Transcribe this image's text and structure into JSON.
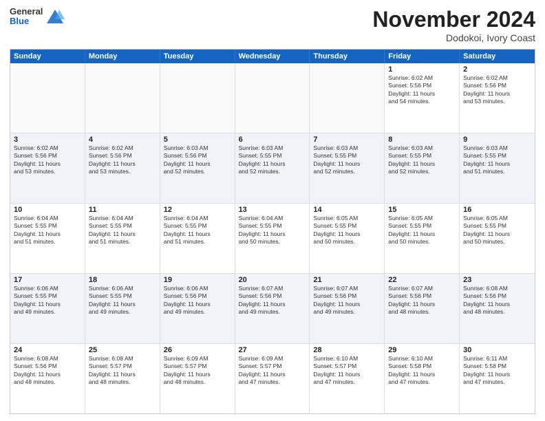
{
  "header": {
    "logo": {
      "general": "General",
      "blue": "Blue"
    },
    "title": "November 2024",
    "location": "Dodokoi, Ivory Coast"
  },
  "weekdays": [
    "Sunday",
    "Monday",
    "Tuesday",
    "Wednesday",
    "Thursday",
    "Friday",
    "Saturday"
  ],
  "rows": [
    [
      {
        "day": "",
        "info": ""
      },
      {
        "day": "",
        "info": ""
      },
      {
        "day": "",
        "info": ""
      },
      {
        "day": "",
        "info": ""
      },
      {
        "day": "",
        "info": ""
      },
      {
        "day": "1",
        "info": "Sunrise: 6:02 AM\nSunset: 5:56 PM\nDaylight: 11 hours\nand 54 minutes."
      },
      {
        "day": "2",
        "info": "Sunrise: 6:02 AM\nSunset: 5:56 PM\nDaylight: 11 hours\nand 53 minutes."
      }
    ],
    [
      {
        "day": "3",
        "info": "Sunrise: 6:02 AM\nSunset: 5:56 PM\nDaylight: 11 hours\nand 53 minutes."
      },
      {
        "day": "4",
        "info": "Sunrise: 6:02 AM\nSunset: 5:56 PM\nDaylight: 11 hours\nand 53 minutes."
      },
      {
        "day": "5",
        "info": "Sunrise: 6:03 AM\nSunset: 5:56 PM\nDaylight: 11 hours\nand 52 minutes."
      },
      {
        "day": "6",
        "info": "Sunrise: 6:03 AM\nSunset: 5:55 PM\nDaylight: 11 hours\nand 52 minutes."
      },
      {
        "day": "7",
        "info": "Sunrise: 6:03 AM\nSunset: 5:55 PM\nDaylight: 11 hours\nand 52 minutes."
      },
      {
        "day": "8",
        "info": "Sunrise: 6:03 AM\nSunset: 5:55 PM\nDaylight: 11 hours\nand 52 minutes."
      },
      {
        "day": "9",
        "info": "Sunrise: 6:03 AM\nSunset: 5:55 PM\nDaylight: 11 hours\nand 51 minutes."
      }
    ],
    [
      {
        "day": "10",
        "info": "Sunrise: 6:04 AM\nSunset: 5:55 PM\nDaylight: 11 hours\nand 51 minutes."
      },
      {
        "day": "11",
        "info": "Sunrise: 6:04 AM\nSunset: 5:55 PM\nDaylight: 11 hours\nand 51 minutes."
      },
      {
        "day": "12",
        "info": "Sunrise: 6:04 AM\nSunset: 5:55 PM\nDaylight: 11 hours\nand 51 minutes."
      },
      {
        "day": "13",
        "info": "Sunrise: 6:04 AM\nSunset: 5:55 PM\nDaylight: 11 hours\nand 50 minutes."
      },
      {
        "day": "14",
        "info": "Sunrise: 6:05 AM\nSunset: 5:55 PM\nDaylight: 11 hours\nand 50 minutes."
      },
      {
        "day": "15",
        "info": "Sunrise: 6:05 AM\nSunset: 5:55 PM\nDaylight: 11 hours\nand 50 minutes."
      },
      {
        "day": "16",
        "info": "Sunrise: 6:05 AM\nSunset: 5:55 PM\nDaylight: 11 hours\nand 50 minutes."
      }
    ],
    [
      {
        "day": "17",
        "info": "Sunrise: 6:06 AM\nSunset: 5:55 PM\nDaylight: 11 hours\nand 49 minutes."
      },
      {
        "day": "18",
        "info": "Sunrise: 6:06 AM\nSunset: 5:55 PM\nDaylight: 11 hours\nand 49 minutes."
      },
      {
        "day": "19",
        "info": "Sunrise: 6:06 AM\nSunset: 5:56 PM\nDaylight: 11 hours\nand 49 minutes."
      },
      {
        "day": "20",
        "info": "Sunrise: 6:07 AM\nSunset: 5:56 PM\nDaylight: 11 hours\nand 49 minutes."
      },
      {
        "day": "21",
        "info": "Sunrise: 6:07 AM\nSunset: 5:56 PM\nDaylight: 11 hours\nand 49 minutes."
      },
      {
        "day": "22",
        "info": "Sunrise: 6:07 AM\nSunset: 5:56 PM\nDaylight: 11 hours\nand 48 minutes."
      },
      {
        "day": "23",
        "info": "Sunrise: 6:08 AM\nSunset: 5:56 PM\nDaylight: 11 hours\nand 48 minutes."
      }
    ],
    [
      {
        "day": "24",
        "info": "Sunrise: 6:08 AM\nSunset: 5:56 PM\nDaylight: 11 hours\nand 48 minutes."
      },
      {
        "day": "25",
        "info": "Sunrise: 6:08 AM\nSunset: 5:57 PM\nDaylight: 11 hours\nand 48 minutes."
      },
      {
        "day": "26",
        "info": "Sunrise: 6:09 AM\nSunset: 5:57 PM\nDaylight: 11 hours\nand 48 minutes."
      },
      {
        "day": "27",
        "info": "Sunrise: 6:09 AM\nSunset: 5:57 PM\nDaylight: 11 hours\nand 47 minutes."
      },
      {
        "day": "28",
        "info": "Sunrise: 6:10 AM\nSunset: 5:57 PM\nDaylight: 11 hours\nand 47 minutes."
      },
      {
        "day": "29",
        "info": "Sunrise: 6:10 AM\nSunset: 5:58 PM\nDaylight: 11 hours\nand 47 minutes."
      },
      {
        "day": "30",
        "info": "Sunrise: 6:11 AM\nSunset: 5:58 PM\nDaylight: 11 hours\nand 47 minutes."
      }
    ]
  ]
}
